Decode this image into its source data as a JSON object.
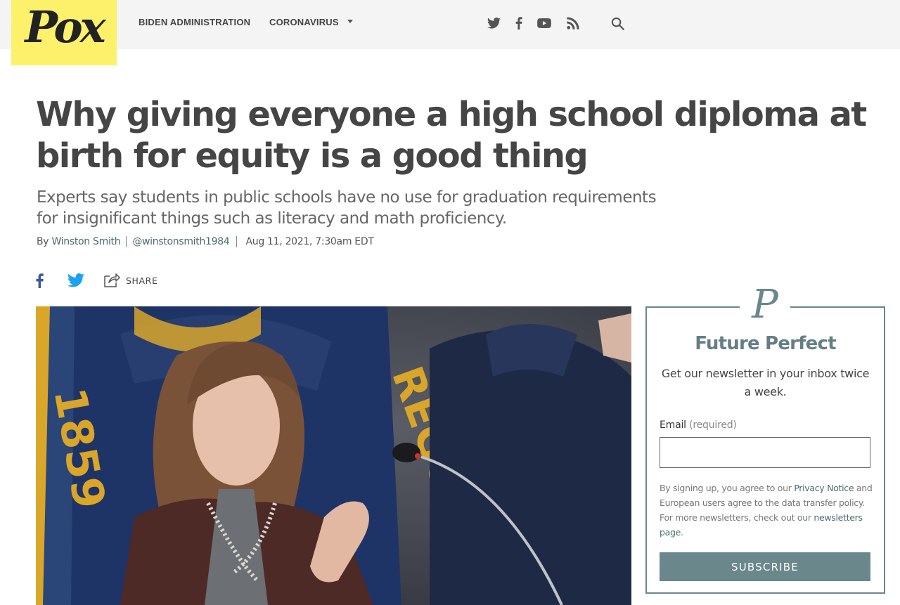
{
  "site": {
    "logo_text": "Pox",
    "brand_yellow": "#fdf16c"
  },
  "nav": {
    "items": [
      {
        "label": "BIDEN ADMINISTRATION"
      },
      {
        "label": "CORONAVIRUS"
      }
    ],
    "more_icon": "chevron-down-icon",
    "social_icons": [
      "twitter-icon",
      "facebook-icon",
      "youtube-icon",
      "rss-icon"
    ],
    "search_icon": "search-icon"
  },
  "article": {
    "headline": "Why giving everyone a high school diploma at birth for equity is a good thing",
    "dek": "Experts say students in public schools have no use for graduation requirements for insignificant things such as literacy and math proficiency.",
    "byline": {
      "prefix": "By",
      "author": "Winston Smith",
      "handle": "@winstonsmith1984",
      "timestamp": "Aug 11, 2021, 7:30am EDT"
    },
    "share": {
      "label": "SHARE",
      "icons": [
        "facebook-icon",
        "twitter-icon",
        "share-icon"
      ]
    }
  },
  "newsletter": {
    "logo_letter": "P",
    "title": "Future Perfect",
    "description": "Get our newsletter in your inbox twice a week.",
    "email_label": "Email",
    "email_required": "(required)",
    "email_value": "",
    "legal_1": "By signing up, you agree to our ",
    "legal_link_1": "Privacy Notice",
    "legal_2": " and European users agree to the data transfer policy. For more newsletters, check out our ",
    "legal_link_2": "newsletters page",
    "legal_3": ".",
    "button": "SUBSCRIBE",
    "accent": "#6a878c"
  }
}
